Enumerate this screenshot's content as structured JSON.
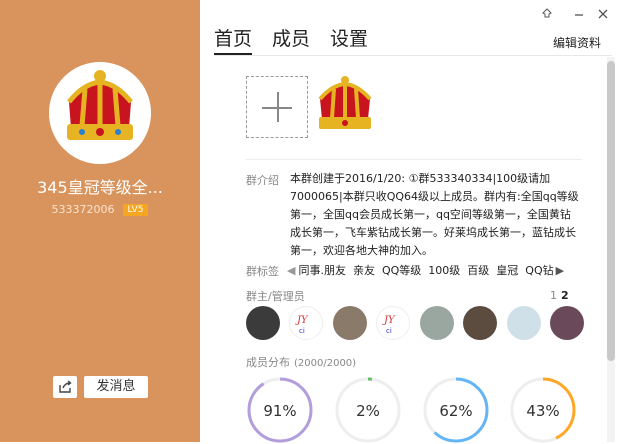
{
  "group": {
    "name": "345皇冠等级全...",
    "id": "533372006",
    "level": "LV5"
  },
  "left_actions": {
    "send_message": "发消息",
    "share_icon": "share-icon"
  },
  "tabs": [
    "首页",
    "成员",
    "设置"
  ],
  "edit_profile": "编辑资料",
  "window_controls": [
    "pin-icon",
    "minimize-icon",
    "close-icon"
  ],
  "intro": {
    "label": "群介绍",
    "text": "本群创建于2016/1/20: ①群533340334|100级请加7000065|本群只收QQ64级以上成员。群内有:全国qq等级第一，全国qq会员成长第一，qq空间等级第一，全国黄钻成长第一，飞车紫钻成长第一。好莱坞成长第一，蓝钻成长第一，欢迎各地大神的加入。"
  },
  "tags": {
    "label": "群标签",
    "items": [
      "同事.朋友",
      "亲友",
      "QQ等级",
      "100级",
      "百级",
      "皇冠",
      "QQ钻"
    ]
  },
  "admins": {
    "label": "群主/管理员",
    "pager": {
      "page1": "1",
      "page2": "2"
    },
    "member_count": 8
  },
  "distribution": {
    "label": "成员分布",
    "count": "(2000/2000)",
    "rings": [
      {
        "label": "91%",
        "value": 0.91,
        "color": "#b39ddb"
      },
      {
        "label": "2%",
        "value": 0.02,
        "color": "#66bb6a"
      },
      {
        "label": "62%",
        "value": 0.62,
        "color": "#64b5f6"
      },
      {
        "label": "43%",
        "value": 0.43,
        "color": "#ffa726"
      }
    ]
  }
}
